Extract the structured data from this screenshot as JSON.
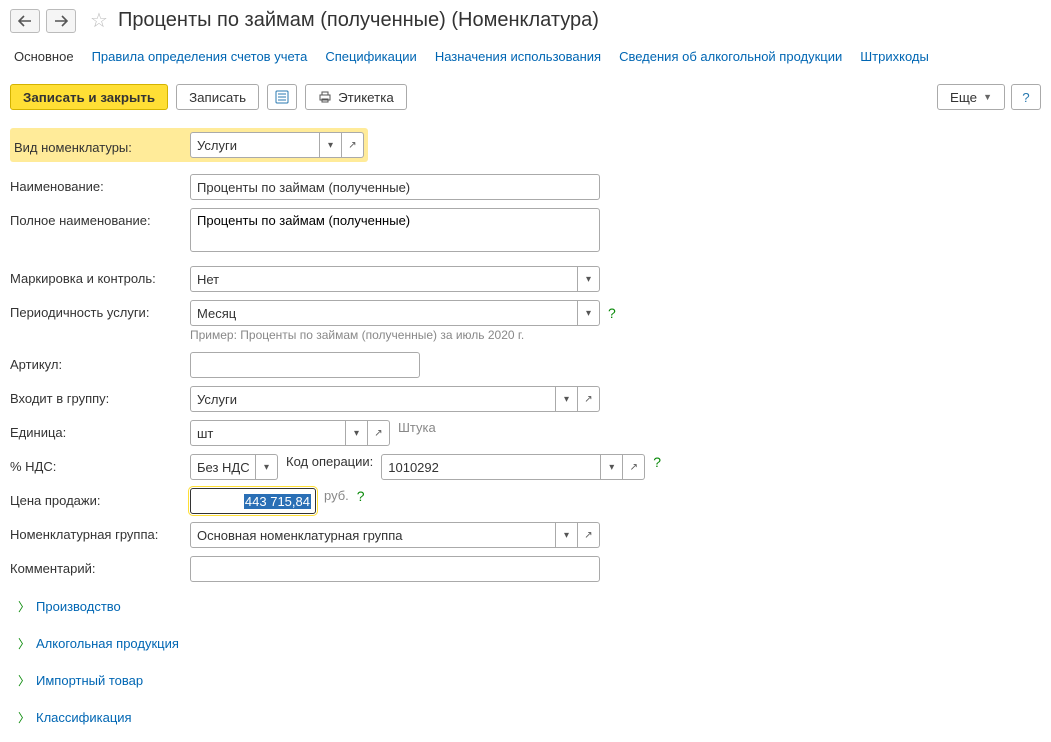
{
  "header": {
    "title": "Проценты по займам (полученные) (Номенклатура)"
  },
  "tabs": {
    "main": "Основное",
    "accounts": "Правила определения счетов учета",
    "specs": "Спецификации",
    "usage": "Назначения использования",
    "alcohol": "Сведения об алкогольной продукции",
    "barcodes": "Штрихкоды"
  },
  "toolbar": {
    "save_close": "Записать и закрыть",
    "save": "Записать",
    "label_btn": "Этикетка",
    "more": "Еще"
  },
  "form": {
    "type_label": "Вид номенклатуры:",
    "type_value": "Услуги",
    "name_label": "Наименование:",
    "name_value": "Проценты по займам (полученные)",
    "fullname_label": "Полное наименование:",
    "fullname_value": "Проценты по займам (полученные)",
    "marking_label": "Маркировка и контроль:",
    "marking_value": "Нет",
    "periodicity_label": "Периодичность услуги:",
    "periodicity_value": "Месяц",
    "periodicity_hint": "Пример: Проценты по займам (полученные) за июль 2020 г.",
    "sku_label": "Артикул:",
    "sku_value": "",
    "group_label": "Входит в группу:",
    "group_value": "Услуги",
    "unit_label": "Единица:",
    "unit_value": "шт",
    "unit_suffix": "Штука",
    "vat_label": "% НДС:",
    "vat_value": "Без НДС",
    "opcode_label": "Код операции:",
    "opcode_value": "1010292",
    "price_label": "Цена продажи:",
    "price_value": "443 715,84",
    "price_currency": "руб.",
    "nomgroup_label": "Номенклатурная группа:",
    "nomgroup_value": "Основная номенклатурная группа",
    "comment_label": "Комментарий:",
    "comment_value": ""
  },
  "sections": {
    "production": "Производство",
    "alcohol": "Алкогольная продукция",
    "import": "Импортный товар",
    "classification": "Классификация"
  }
}
